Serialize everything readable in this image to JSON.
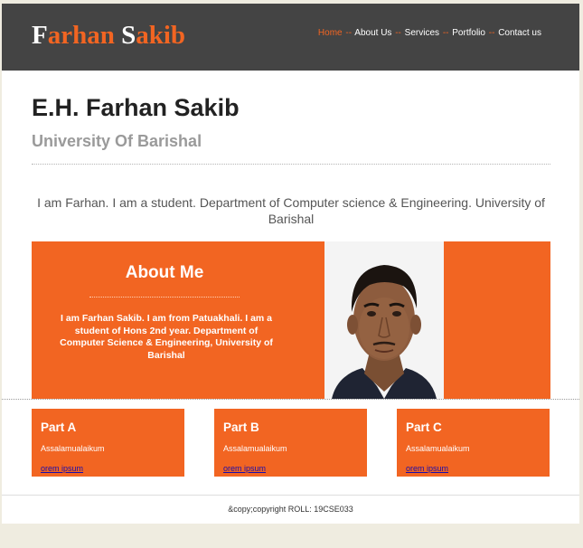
{
  "header": {
    "logo": {
      "first_initial": "F",
      "first_rest": "arhan",
      "last_initial": "S",
      "last_rest": "akib"
    },
    "nav": {
      "separator": "--",
      "items": [
        {
          "label": "Home",
          "active": true
        },
        {
          "label": "About Us",
          "active": false
        },
        {
          "label": "Services",
          "active": false
        },
        {
          "label": "Portfolio",
          "active": false
        },
        {
          "label": "Contact us",
          "active": false
        }
      ]
    }
  },
  "profile": {
    "name": "E.H. Farhan Sakib",
    "university": "University Of Barishal",
    "intro": "I am Farhan. I am a student. Department of Computer science & Engineering. University of Barishal"
  },
  "about": {
    "title": "About Me",
    "text": "I am Farhan Sakib. I am from Patuakhali. I am a student of Hons 2nd year. Department of Computer Science & Engineering, University of Barishal"
  },
  "parts": [
    {
      "title": "Part A",
      "text": "Assalamualaikum",
      "link": "orem ipsum"
    },
    {
      "title": "Part B",
      "text": "Assalamualaikum",
      "link": "orem ipsum"
    },
    {
      "title": "Part C",
      "text": "Assalamualaikum",
      "link": "orem ipsum"
    }
  ],
  "footer": {
    "text": "&copy;copyright ROLL: 19CSE033"
  },
  "colors": {
    "accent": "#f26522",
    "header_bg": "#444444",
    "page_bg": "#efece0"
  }
}
